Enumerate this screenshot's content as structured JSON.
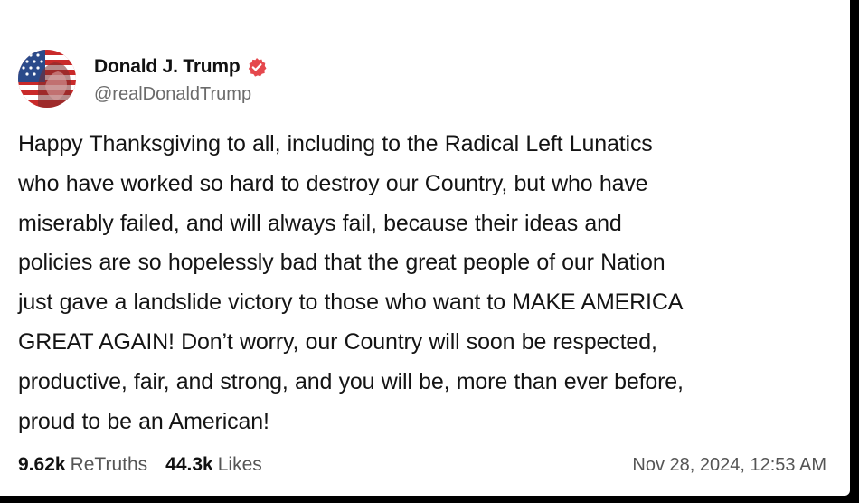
{
  "post": {
    "author": {
      "display_name": "Donald J. Trump",
      "handle": "@realDonaldTrump",
      "verified_icon": "verified-badge-icon",
      "verified_color": "#e5484d"
    },
    "body_lines": [
      "Happy Thanksgiving to all, including to the Radical Left Lunatics",
      "who have worked so hard to destroy our Country, but who have",
      "miserably failed, and will always fail, because their ideas and",
      "policies are so hopelessly bad that the great people of our Nation",
      "just gave a landslide victory to those who want to MAKE AMERICA",
      "GREAT AGAIN! Don’t worry, our Country will soon be respected,",
      "productive, fair, and strong, and you will be, more than ever before,",
      "proud to be an American!"
    ],
    "stats": {
      "retruths_count": "9.62k",
      "retruths_label": "ReTruths",
      "likes_count": "44.3k",
      "likes_label": "Likes"
    },
    "timestamp": "Nov 28, 2024, 12:53 AM"
  }
}
